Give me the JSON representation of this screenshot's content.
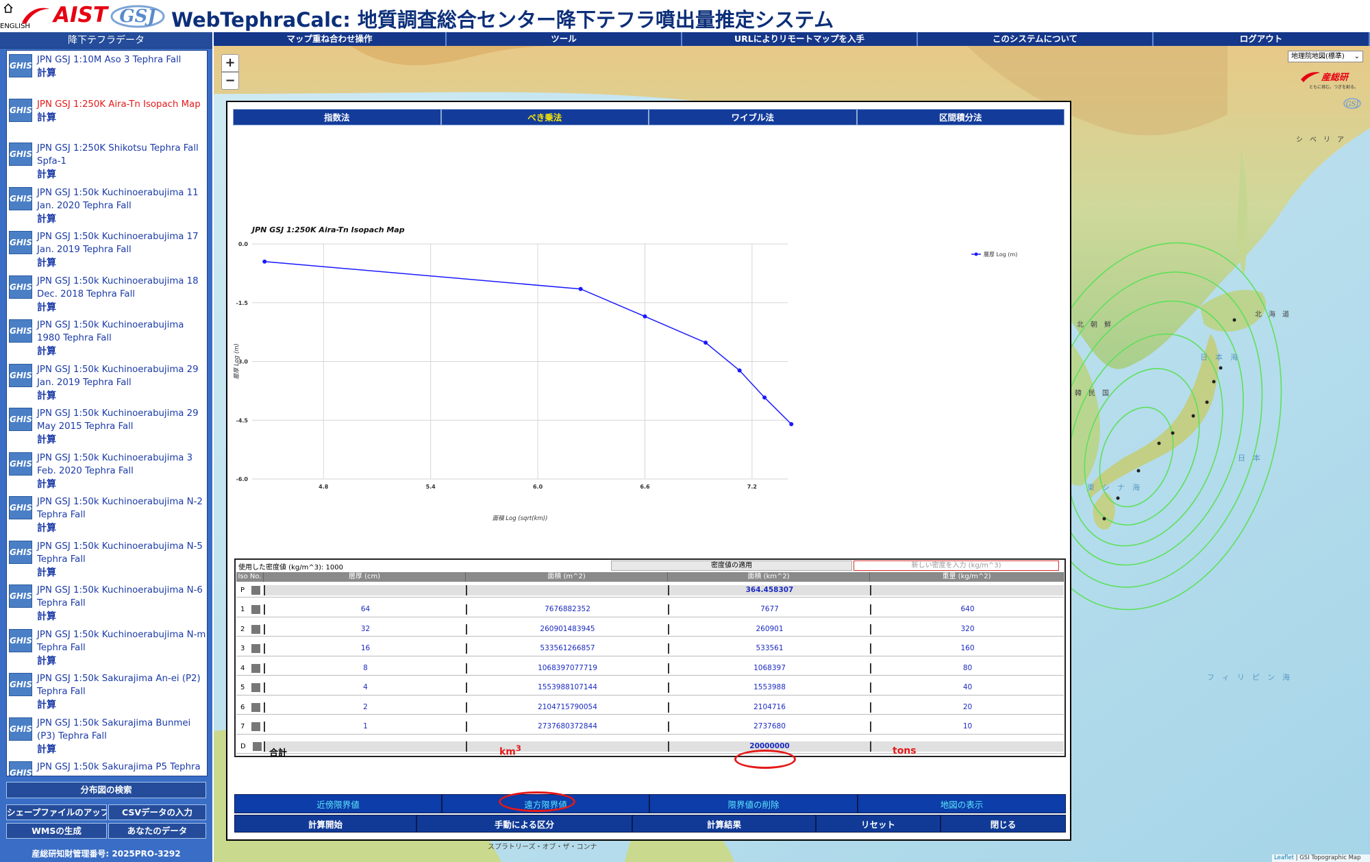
{
  "header": {
    "english_link": "ENGLISH",
    "aist_logo_text": "AIST",
    "gsj_logo_text": "GSJ",
    "title": "WebTephraCalc: 地質調査総合センター降下テフラ噴出量推定システム"
  },
  "sidebar": {
    "header": "降下テフラデータ",
    "icon_text": "GHIS",
    "calc_label": "計算",
    "items": [
      {
        "name": "JPN GSJ 1:10M Aso 3 Tephra Fall",
        "active": false
      },
      {
        "name": "JPN GSJ 1:250K Aira-Tn Isopach Map",
        "active": true
      },
      {
        "name": "JPN GSJ 1:250K Shikotsu Tephra Fall Spfa-1",
        "active": false
      },
      {
        "name": "JPN GSJ 1:50k Kuchinoerabujima 11 Jan. 2020 Tephra Fall",
        "active": false
      },
      {
        "name": "JPN GSJ 1:50k Kuchinoerabujima 17 Jan. 2019 Tephra Fall",
        "active": false
      },
      {
        "name": "JPN GSJ 1:50k Kuchinoerabujima 18 Dec. 2018 Tephra Fall",
        "active": false
      },
      {
        "name": "JPN GSJ 1:50k Kuchinoerabujima 1980 Tephra Fall",
        "active": false
      },
      {
        "name": "JPN GSJ 1:50k Kuchinoerabujima 29 Jan. 2019 Tephra Fall",
        "active": false
      },
      {
        "name": "JPN GSJ 1:50k Kuchinoerabujima 29 May 2015 Tephra Fall",
        "active": false
      },
      {
        "name": "JPN GSJ 1:50k Kuchinoerabujima 3 Feb. 2020 Tephra Fall",
        "active": false
      },
      {
        "name": "JPN GSJ 1:50k Kuchinoerabujima N-2 Tephra Fall",
        "active": false
      },
      {
        "name": "JPN GSJ 1:50k Kuchinoerabujima N-5 Tephra Fall",
        "active": false
      },
      {
        "name": "JPN GSJ 1:50k Kuchinoerabujima N-6 Tephra Fall",
        "active": false
      },
      {
        "name": "JPN GSJ 1:50k Kuchinoerabujima N-m Tephra Fall",
        "active": false
      },
      {
        "name": "JPN GSJ 1:50k Sakurajima An-ei (P2) Tephra Fall",
        "active": false
      },
      {
        "name": "JPN GSJ 1:50k Sakurajima Bunmei (P3) Tephra Fall",
        "active": false
      },
      {
        "name": "JPN GSJ 1:50k Sakurajima P5 Tephra Fall",
        "active": false
      }
    ],
    "search_button": "分布図の検索",
    "shapefile_button": "シェープファイルのアップロード",
    "csv_button": "CSVデータの入力",
    "wms_button": "WMSの生成",
    "your_data_button": "あなたのデータ",
    "ip_number": "産総研知財管理番号: 2025PRO-3292"
  },
  "menu": [
    "マップ重ね合わせ操作",
    "ツール",
    "URLによりリモートマップを入手",
    "このシステムについて",
    "ログアウト"
  ],
  "map": {
    "zoom_in": "+",
    "zoom_out": "−",
    "layer_select": "地理院地図(標準)",
    "aist_map_logo": "産総研",
    "aist_map_tagline": "ともに挑む。つぎを創る。",
    "attribution_leaflet": "Leaflet",
    "attribution_rest": " | GSI Topographic Map",
    "labels": {
      "japan_sea": "日　本　海",
      "east_china_sea": "東　シ　ナ　海",
      "philippine_sea": "フ　ィ　リ　ピ　ン　海",
      "japan": "日　本",
      "korea": "大　韓　民　国",
      "dprk": "北　朝　鮮",
      "siberia": "シ　ベ　リ　ア",
      "north_sea": "北　海　道",
      "spratly": "スプラトリーズ・オブ・ザ・コンナ"
    }
  },
  "dialog": {
    "tabs": [
      {
        "label": "指数法",
        "active": false
      },
      {
        "label": "べき乗法",
        "active": true
      },
      {
        "label": "ワイブル法",
        "active": false
      },
      {
        "label": "区間積分法",
        "active": false
      }
    ],
    "density_used": "使用した密度値 (kg/m^3): 1000",
    "density_apply": "密度値の適用",
    "density_input_placeholder": "新しい密度を入力 (kg/m^3)",
    "columns": [
      "Iso No.",
      "層厚 (cm)",
      "面積 (m^2)",
      "面積 (km^2)",
      "重量 (kg/m^2)"
    ],
    "rows": [
      {
        "no": "P",
        "thickness": "",
        "area_m2": "",
        "area_km2": "364.458307",
        "weight": "",
        "shaded": true,
        "bold": true
      },
      {
        "no": "1",
        "thickness": "64",
        "area_m2": "7676882352",
        "area_km2": "7677",
        "weight": "640",
        "shaded": false,
        "bold": false
      },
      {
        "no": "2",
        "thickness": "32",
        "area_m2": "260901483945",
        "area_km2": "260901",
        "weight": "320",
        "shaded": false,
        "bold": false
      },
      {
        "no": "3",
        "thickness": "16",
        "area_m2": "533561266857",
        "area_km2": "533561",
        "weight": "160",
        "shaded": false,
        "bold": false
      },
      {
        "no": "4",
        "thickness": "8",
        "area_m2": "1068397077719",
        "area_km2": "1068397",
        "weight": "80",
        "shaded": false,
        "bold": false
      },
      {
        "no": "5",
        "thickness": "4",
        "area_m2": "1553988107144",
        "area_km2": "1553988",
        "weight": "40",
        "shaded": false,
        "bold": false
      },
      {
        "no": "6",
        "thickness": "2",
        "area_m2": "2104715790054",
        "area_km2": "2104716",
        "weight": "20",
        "shaded": false,
        "bold": false
      },
      {
        "no": "7",
        "thickness": "1",
        "area_m2": "2737680372844",
        "area_km2": "2737680",
        "weight": "10",
        "shaded": false,
        "bold": false
      },
      {
        "no": "D",
        "thickness": "",
        "area_m2": "",
        "area_km2": "20000000",
        "weight": "",
        "shaded": true,
        "bold": true
      }
    ],
    "total_label": "合計",
    "unit_volume": "km",
    "unit_volume_sup": "3",
    "unit_mass": "tons",
    "buttons_row1": [
      "近傍限界値",
      "遠方限界値",
      "限界値の削除",
      "地図の表示"
    ],
    "buttons_row2": [
      "計算開始",
      "手動による区分",
      "計算結果",
      "リセット",
      "閉じる"
    ]
  },
  "chart_data": {
    "type": "line",
    "title": "JPN GSJ 1:250K Aira-Tn Isopach Map",
    "xlabel": "面積 Log (sqrt(km))",
    "ylabel": "層厚 Log (m)",
    "xlim": [
      4.4,
      7.4
    ],
    "ylim": [
      -6.0,
      0.0
    ],
    "x_ticks": [
      "4.8",
      "5.4",
      "6.0",
      "6.6",
      "7.2"
    ],
    "y_ticks": [
      "0.0",
      "-1.5",
      "-3.0",
      "-4.5",
      "-6.0"
    ],
    "grid": true,
    "legend_position": "top-right",
    "series": [
      {
        "name": "層厚 Log (m)",
        "color": "#1a1aff",
        "x": [
          4.47,
          6.24,
          6.6,
          6.94,
          7.13,
          7.27,
          7.42
        ],
        "y": [
          -0.45,
          -1.15,
          -1.85,
          -2.52,
          -3.23,
          -3.92,
          -4.6
        ]
      }
    ]
  }
}
